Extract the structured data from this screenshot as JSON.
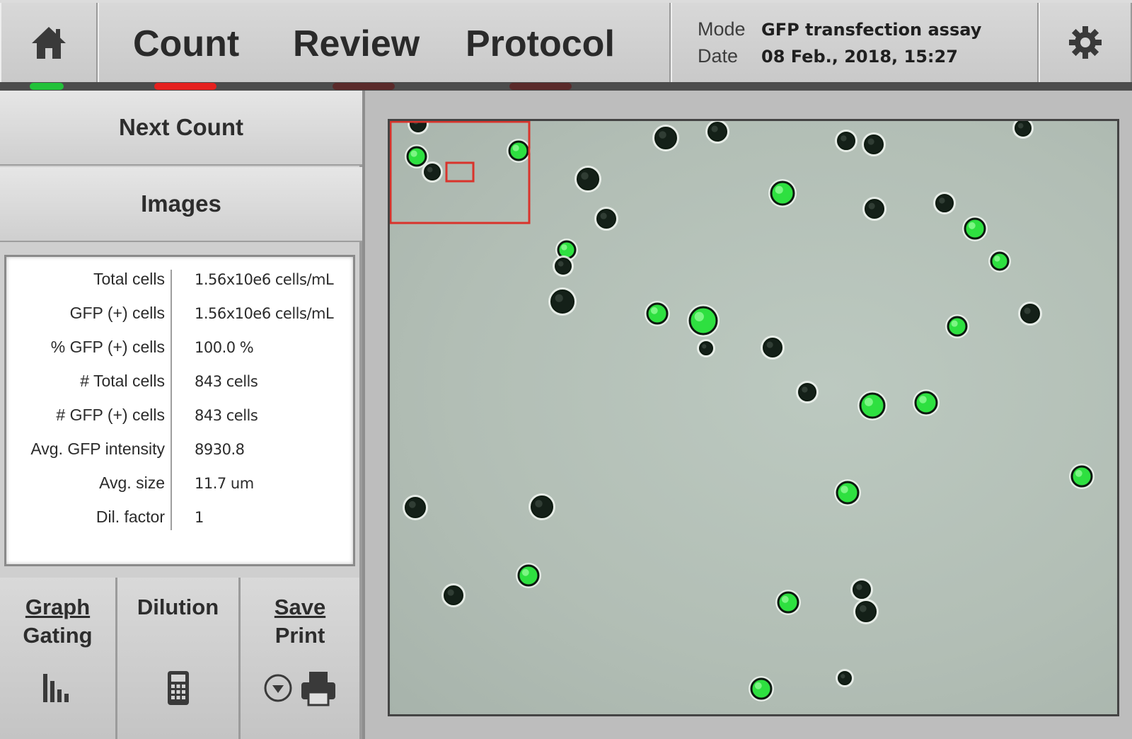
{
  "header": {
    "tabs": [
      {
        "label": "Count",
        "active": true
      },
      {
        "label": "Review",
        "active": false
      },
      {
        "label": "Protocol",
        "active": false
      }
    ],
    "mode_label": "Mode",
    "mode_value": "GFP transfection assay",
    "date_label": "Date",
    "date_value": "08 Feb., 2018, 15:27",
    "indicator_colors": {
      "home": "#22c23a",
      "active_tab": "#e5201e",
      "inactive": "#5a2a2a"
    }
  },
  "sidebar": {
    "next_count_label": "Next Count",
    "images_label": "Images"
  },
  "stats": [
    {
      "label": "Total cells",
      "value": "1.56x10e6 cells/mL"
    },
    {
      "label": "GFP (+) cells",
      "value": "1.56x10e6 cells/mL"
    },
    {
      "label": "% GFP (+) cells",
      "value": "100.0 %"
    },
    {
      "label": "# Total cells",
      "value": "843 cells"
    },
    {
      "label": "# GFP (+) cells",
      "value": "843 cells"
    },
    {
      "label": "Avg. GFP intensity",
      "value": "8930.8"
    },
    {
      "label": "Avg. size",
      "value": "11.7 um"
    },
    {
      "label": "Dil. factor",
      "value": "1"
    }
  ],
  "bottom_buttons": {
    "graph_line1": "Graph",
    "graph_line2": "Gating",
    "dilution": "Dilution",
    "save_line1": "Save",
    "save_line2": "Print"
  },
  "image_view": {
    "cell_colors": {
      "gfp": "#2ee040",
      "dark": "#142018"
    },
    "zoom_box_color": "#d9332b"
  }
}
